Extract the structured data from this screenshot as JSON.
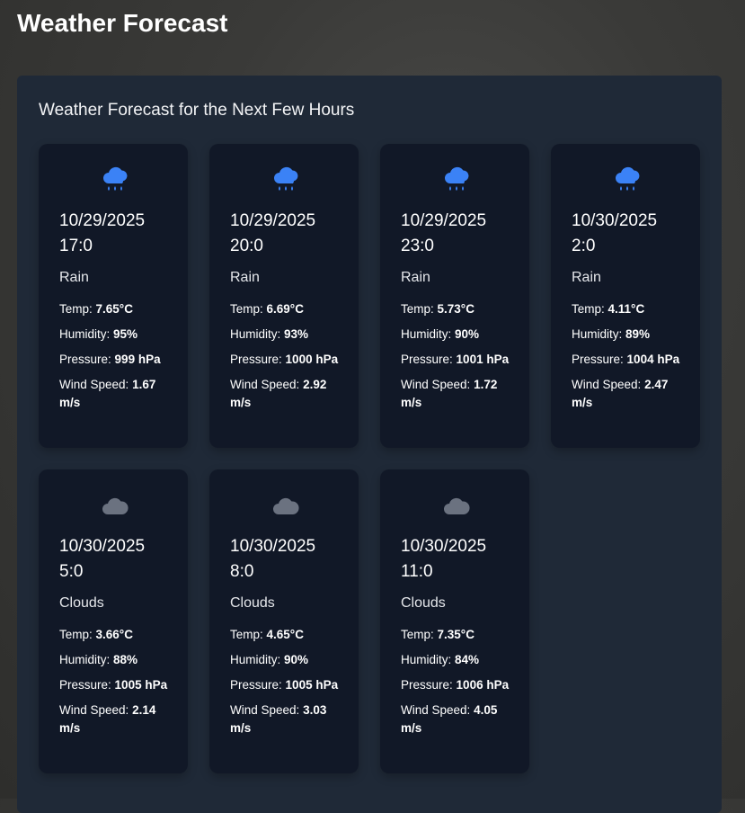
{
  "page": {
    "title": "Weather Forecast"
  },
  "panel": {
    "heading": "Weather Forecast for the Next Few Hours"
  },
  "labels": {
    "temp": "Temp:",
    "humidity": "Humidity:",
    "pressure": "Pressure:",
    "wind": "Wind Speed:"
  },
  "colors": {
    "rain_icon": "#3b82f6",
    "cloud_icon": "#6b7280",
    "card_bg": "#111827",
    "panel_bg": "#1f2937"
  },
  "forecasts": [
    {
      "icon": "rain-cloud-icon",
      "date": "10/29/2025",
      "time": "17:0",
      "condition": "Rain",
      "temp": "7.65°C",
      "humidity": "95%",
      "pressure": "999 hPa",
      "wind": "1.67 m/s"
    },
    {
      "icon": "rain-cloud-icon",
      "date": "10/29/2025",
      "time": "20:0",
      "condition": "Rain",
      "temp": "6.69°C",
      "humidity": "93%",
      "pressure": "1000 hPa",
      "wind": "2.92 m/s"
    },
    {
      "icon": "rain-cloud-icon",
      "date": "10/29/2025",
      "time": "23:0",
      "condition": "Rain",
      "temp": "5.73°C",
      "humidity": "90%",
      "pressure": "1001 hPa",
      "wind": "1.72 m/s"
    },
    {
      "icon": "rain-cloud-icon",
      "date": "10/30/2025",
      "time": "2:0",
      "condition": "Rain",
      "temp": "4.11°C",
      "humidity": "89%",
      "pressure": "1004 hPa",
      "wind": "2.47 m/s"
    },
    {
      "icon": "cloud-icon",
      "date": "10/30/2025",
      "time": "5:0",
      "condition": "Clouds",
      "temp": "3.66°C",
      "humidity": "88%",
      "pressure": "1005 hPa",
      "wind": "2.14 m/s"
    },
    {
      "icon": "cloud-icon",
      "date": "10/30/2025",
      "time": "8:0",
      "condition": "Clouds",
      "temp": "4.65°C",
      "humidity": "90%",
      "pressure": "1005 hPa",
      "wind": "3.03 m/s"
    },
    {
      "icon": "cloud-icon",
      "date": "10/30/2025",
      "time": "11:0",
      "condition": "Clouds",
      "temp": "7.35°C",
      "humidity": "84%",
      "pressure": "1006 hPa",
      "wind": "4.05 m/s"
    }
  ]
}
